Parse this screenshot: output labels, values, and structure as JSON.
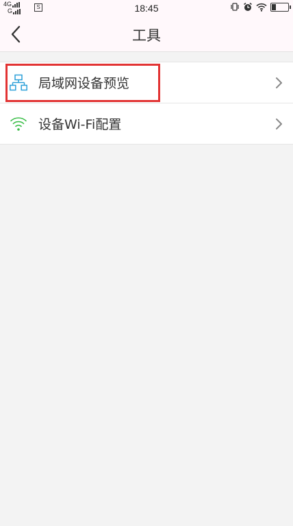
{
  "status_bar": {
    "network_top": "4G",
    "network_bottom": "G",
    "sim_label": "S",
    "time": "18:45"
  },
  "nav": {
    "title": "工具"
  },
  "menu": {
    "items": [
      {
        "label": "局域网设备预览",
        "icon": "lan-network-icon",
        "highlighted": true
      },
      {
        "label": "设备Wi-Fi配置",
        "icon": "wifi-icon",
        "highlighted": false
      }
    ]
  },
  "colors": {
    "lan_icon": "#2a9fd8",
    "wifi_icon": "#3cbf4a",
    "highlight": "#e23333",
    "background": "#f3f3f3"
  }
}
